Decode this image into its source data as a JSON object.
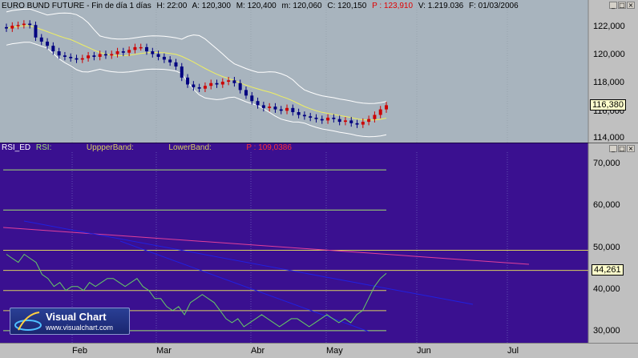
{
  "price_header": {
    "symbol": "EURO BUND FUTURE - Fin de día 1 días",
    "h": "H: 22:00",
    "a": "A: 120,300",
    "m": "M: 120,400",
    "mm": "m: 120,060",
    "c": "C: 120,150",
    "p": "P : 123,910",
    "v": "V: 1.219.036",
    "f": "F: 01/03/2006"
  },
  "rsi_header": {
    "name": "RSI_ED",
    "rsi": "RSI:",
    "upper": "UppperBand:",
    "lower": "LowerBand:",
    "p": "P : 109,0386"
  },
  "price_axis": [
    "122,000",
    "120,000",
    "118,000",
    "116,000",
    "114,000"
  ],
  "price_last": "116,380",
  "rsi_axis": [
    "70,000",
    "60,000",
    "50,000",
    "40,000",
    "30,000"
  ],
  "rsi_last": "44,261",
  "months": [
    "Feb",
    "Mar",
    "Abr",
    "May",
    "Jun",
    "Jul"
  ],
  "logo": {
    "title": "Visual Chart",
    "url": "www.visualchart.com"
  },
  "colors": {
    "price_bg": "#a8b4be",
    "rsi_bg": "#3a1090",
    "band": "#ffffff",
    "ma": "#f0f060",
    "candle_up": "#cc0000",
    "candle_down": "#000080",
    "rsi_line": "#66cc66",
    "trend_pink": "#e0409a",
    "trend_blue": "#2020e0",
    "level_line": "#d8d060",
    "level_line2": "#a0e070"
  },
  "chart_data": [
    {
      "type": "line",
      "title": "EURO BUND FUTURE - Fin de día 1 días",
      "ylim": [
        114,
        123.5
      ],
      "closes": [
        122.25,
        122.45,
        122.5,
        122.6,
        122.5,
        121.6,
        121.3,
        121.0,
        120.6,
        120.3,
        120.2,
        120.1,
        120.0,
        120.1,
        120.3,
        120.2,
        120.4,
        120.3,
        120.4,
        120.6,
        120.5,
        120.7,
        120.9,
        120.9,
        120.6,
        120.4,
        120.2,
        120.0,
        119.8,
        119.5,
        118.7,
        118.2,
        118.0,
        117.9,
        118.1,
        118.3,
        118.2,
        118.4,
        118.5,
        118.3,
        117.8,
        117.4,
        117.0,
        116.7,
        116.5,
        116.6,
        116.4,
        116.3,
        116.5,
        116.2,
        116.0,
        115.9,
        115.8,
        115.7,
        115.6,
        115.8,
        115.7,
        115.5,
        115.6,
        115.4,
        115.3,
        115.5,
        115.7,
        116.0,
        116.4,
        116.7
      ],
      "bands": "bollinger",
      "ma": true
    },
    {
      "type": "line",
      "title": "RSI_ED",
      "ylim": [
        27,
        74
      ],
      "rsi": [
        49,
        48,
        47,
        49,
        48,
        47,
        44,
        43,
        41,
        42,
        40,
        41,
        41,
        40,
        42,
        41,
        42,
        43,
        43,
        42,
        41,
        42,
        43,
        41,
        40,
        38,
        38,
        36,
        35,
        36,
        34,
        37,
        38,
        39,
        38,
        37,
        35,
        33,
        32,
        33,
        31,
        32,
        33,
        34,
        33,
        32,
        31,
        32,
        33,
        33,
        32,
        31,
        32,
        33,
        34,
        33,
        32,
        33,
        32,
        34,
        35,
        38,
        41,
        43,
        44.261
      ],
      "upper_levels": [
        70,
        60,
        50,
        45
      ],
      "lower_levels": [
        40,
        35,
        30
      ]
    }
  ]
}
